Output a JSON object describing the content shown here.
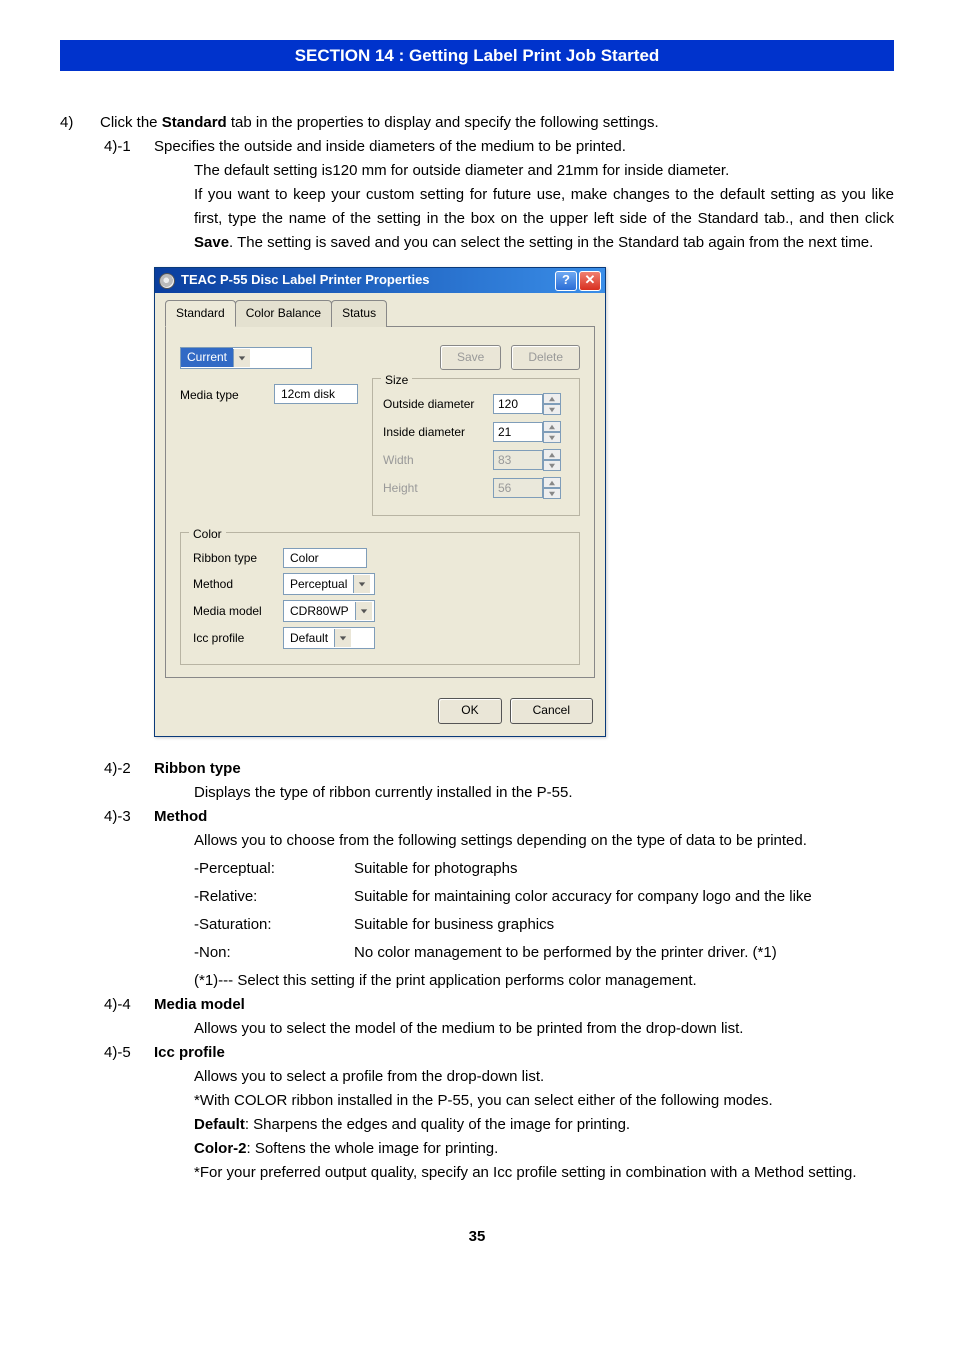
{
  "section_banner": "SECTION 14 : Getting Label Print Job Started",
  "step4": {
    "num": "4)",
    "line1_a": "Click the ",
    "line1_bold": "Standard",
    "line1_b": " tab in the properties to display and specify the following settings."
  },
  "s41": {
    "num": "4)-1",
    "line": "Specifies the outside and inside diameters of the medium to be printed.",
    "p1": "The default setting is120 mm for outside diameter and 21mm for inside diameter.",
    "p2": "If you want to keep your custom setting for future use, make changes to the default setting as you like first, type the name of the setting in the box on the upper left side of the Standard tab., and then click ",
    "p2_bold": "Save",
    "p2b": ". The setting is saved and you can select the setting in the Standard tab again from the next time."
  },
  "dialog": {
    "title": "TEAC P-55 Disc Label Printer Properties",
    "tabs": {
      "standard": "Standard",
      "color_balance": "Color Balance",
      "status": "Status"
    },
    "current_label": "Current",
    "save_btn": "Save",
    "delete_btn": "Delete",
    "media_type_label": "Media type",
    "media_type_value": "12cm disk",
    "size_legend": "Size",
    "outside_label": "Outside diameter",
    "outside_value": "120",
    "inside_label": "Inside diameter",
    "inside_value": "21",
    "width_label": "Width",
    "width_value": "83",
    "height_label": "Height",
    "height_value": "56",
    "color_legend": "Color",
    "ribbon_label": "Ribbon type",
    "ribbon_value": "Color",
    "method_label": "Method",
    "method_value": "Perceptual",
    "model_label": "Media model",
    "model_value": "CDR80WP",
    "icc_label": "Icc profile",
    "icc_value": "Default",
    "ok": "OK",
    "cancel": "Cancel"
  },
  "s42": {
    "num": "4)-2",
    "title": "Ribbon type",
    "desc": "Displays the type of ribbon currently installed in the P-55."
  },
  "s43": {
    "num": "4)-3",
    "title": "Method",
    "desc": "Allows you to choose from the following settings depending on the type of data to be printed.",
    "rows": [
      {
        "term": "-Perceptual:",
        "def": "Suitable for photographs"
      },
      {
        "term": "-Relative:",
        "def": "Suitable for maintaining color accuracy for company logo and the like"
      },
      {
        "term": "-Saturation:",
        "def": "Suitable for business graphics"
      },
      {
        "term": "-Non:",
        "def": "No color management to be performed by the printer driver. (*1)"
      }
    ],
    "note": "(*1)--- Select this setting if the print application performs color management."
  },
  "s44": {
    "num": "4)-4",
    "title": "Media model",
    "desc": "Allows you to select the model of the medium to be printed from the drop-down list."
  },
  "s45": {
    "num": "4)-5",
    "title": "Icc profile",
    "l1": "Allows you to select a profile from the drop-down list.",
    "l2": "*With COLOR ribbon installed in the P-55, you can select either of the following modes.",
    "l3_bold": "Default",
    "l3": ": Sharpens the edges and quality of the image for printing.",
    "l4_bold": "Color-2",
    "l4": ": Softens the whole image for printing.",
    "l5": "*For your preferred output quality, specify an Icc profile setting in combination with a Method setting."
  },
  "page_num": "35"
}
